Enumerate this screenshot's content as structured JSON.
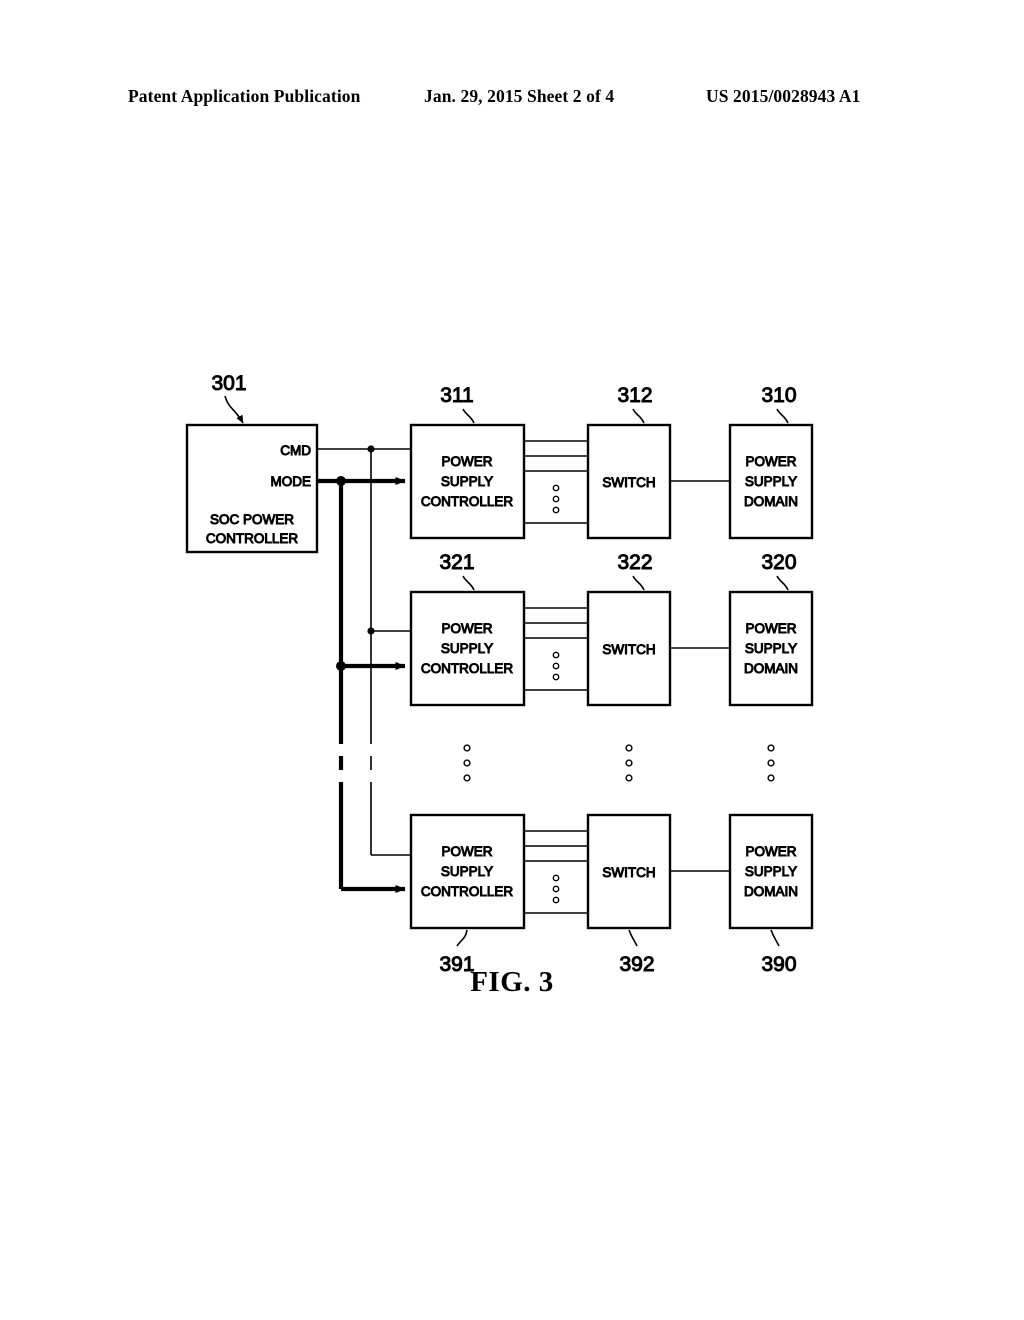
{
  "header": {
    "publication": "Patent Application Publication",
    "date_sheet": "Jan. 29, 2015  Sheet 2 of 4",
    "patent_number": "US 2015/0028943 A1"
  },
  "figure": {
    "caption": "FIG. 3",
    "controller": {
      "ref": "301",
      "label_line1": "SOC POWER",
      "label_line2": "CONTROLLER",
      "ports": [
        {
          "name": "cmd",
          "label": "CMD"
        },
        {
          "name": "mode",
          "label": "MODE"
        }
      ]
    },
    "rows": [
      {
        "id": "row-1",
        "psc": {
          "ref": "311",
          "ref_position": "above",
          "line1": "POWER",
          "line2": "SUPPLY",
          "line3": "CONTROLLER"
        },
        "switch": {
          "ref": "312",
          "ref_position": "above",
          "label": "SWITCH"
        },
        "domain": {
          "ref": "310",
          "ref_position": "above",
          "line1": "POWER",
          "line2": "SUPPLY",
          "line3": "DOMAIN"
        }
      },
      {
        "id": "row-2",
        "psc": {
          "ref": "321",
          "ref_position": "above",
          "line1": "POWER",
          "line2": "SUPPLY",
          "line3": "CONTROLLER"
        },
        "switch": {
          "ref": "322",
          "ref_position": "above",
          "label": "SWITCH"
        },
        "domain": {
          "ref": "320",
          "ref_position": "above",
          "line1": "POWER",
          "line2": "SUPPLY",
          "line3": "DOMAIN"
        }
      },
      {
        "id": "row-n",
        "psc": {
          "ref": "391",
          "ref_position": "below",
          "line1": "POWER",
          "line2": "SUPPLY",
          "line3": "CONTROLLER"
        },
        "switch": {
          "ref": "392",
          "ref_position": "below",
          "label": "SWITCH"
        },
        "domain": {
          "ref": "390",
          "ref_position": "below",
          "line1": "POWER",
          "line2": "SUPPLY",
          "line3": "DOMAIN"
        }
      }
    ],
    "ellipsis": {
      "symbol": "vertical-ellipsis",
      "dot_count": 3,
      "columns": [
        "psc-column",
        "switch-column",
        "domain-column"
      ]
    },
    "buses": [
      {
        "name": "mode-bus",
        "style": "thick",
        "dashed_middle": true
      },
      {
        "name": "cmd-bus",
        "style": "thin",
        "dashed_middle": true
      }
    ],
    "colors": {
      "ink": "#000000",
      "paper": "#ffffff"
    }
  }
}
